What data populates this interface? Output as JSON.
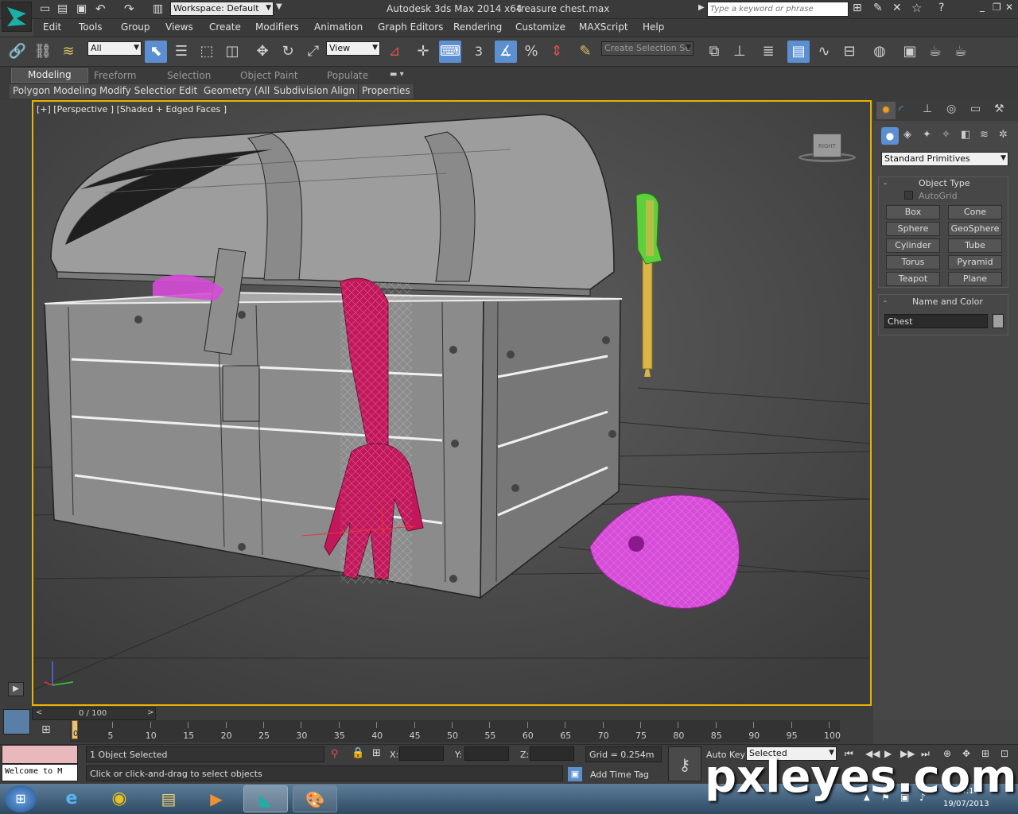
{
  "titlebar": {
    "workspace": "Workspace: Default",
    "app_title": "Autodesk 3ds Max  2014 x64",
    "file_name": "treasure chest.max",
    "search_placeholder": "Type a keyword or phrase"
  },
  "menu": {
    "items": [
      "Edit",
      "Tools",
      "Group",
      "Views",
      "Create",
      "Modifiers",
      "Animation",
      "Graph Editors",
      "Rendering",
      "Customize",
      "MAXScript",
      "Help"
    ]
  },
  "toolbar": {
    "selection_filter": "All",
    "ref_coord": "View",
    "selection_set_placeholder": "Create Selection Se",
    "snap_label": "3"
  },
  "ribbon": {
    "tabs": [
      "Modeling",
      "Freeform",
      "Selection",
      "Object Paint",
      "Populate"
    ],
    "subtabs": [
      "Polygon Modeling",
      "Modify Selection",
      "Edit",
      "Geometry (All)",
      "Subdivision",
      "Align",
      "Properties"
    ]
  },
  "viewport": {
    "label": "[+] [Perspective ] [Shaded + Edged Faces ]",
    "viewcube_label": "RIGHT"
  },
  "cmdpanel": {
    "category": "Standard Primitives",
    "object_type_title": "Object Type",
    "autogrid": "AutoGrid",
    "buttons": [
      "Box",
      "Cone",
      "Sphere",
      "GeoSphere",
      "Cylinder",
      "Tube",
      "Torus",
      "Pyramid",
      "Teapot",
      "Plane"
    ],
    "name_color_title": "Name and Color",
    "object_name": "Chest",
    "object_color": "#a0a0a0"
  },
  "timeline": {
    "frame_display": "0 / 100",
    "ticks": [
      "5",
      "10",
      "15",
      "20",
      "25",
      "30",
      "35",
      "40",
      "45",
      "50",
      "55",
      "60",
      "65",
      "70",
      "75",
      "80",
      "85",
      "90",
      "95",
      "100"
    ],
    "first_tick": "0"
  },
  "status": {
    "listener": "Welcome to M",
    "selected": "1 Object Selected",
    "prompt": "Click or click-and-drag to select objects",
    "x_label": "X:",
    "y_label": "Y:",
    "z_label": "Z:",
    "grid": "Grid = 0.254m",
    "add_time_tag": "Add Time Tag",
    "auto_key": "Auto Key",
    "key_filter": "Selected"
  },
  "taskbar": {
    "time": "14:16",
    "date": "19/07/2013"
  },
  "watermark": "pxleyes.com",
  "colors": {
    "accent": "#e8b400",
    "active_blue": "#5b8fd2",
    "skeleton": "#c2185b",
    "skull": "#d64bd8",
    "dagger_handle": "#5ed13a",
    "dagger_blade": "#d9b54a"
  }
}
